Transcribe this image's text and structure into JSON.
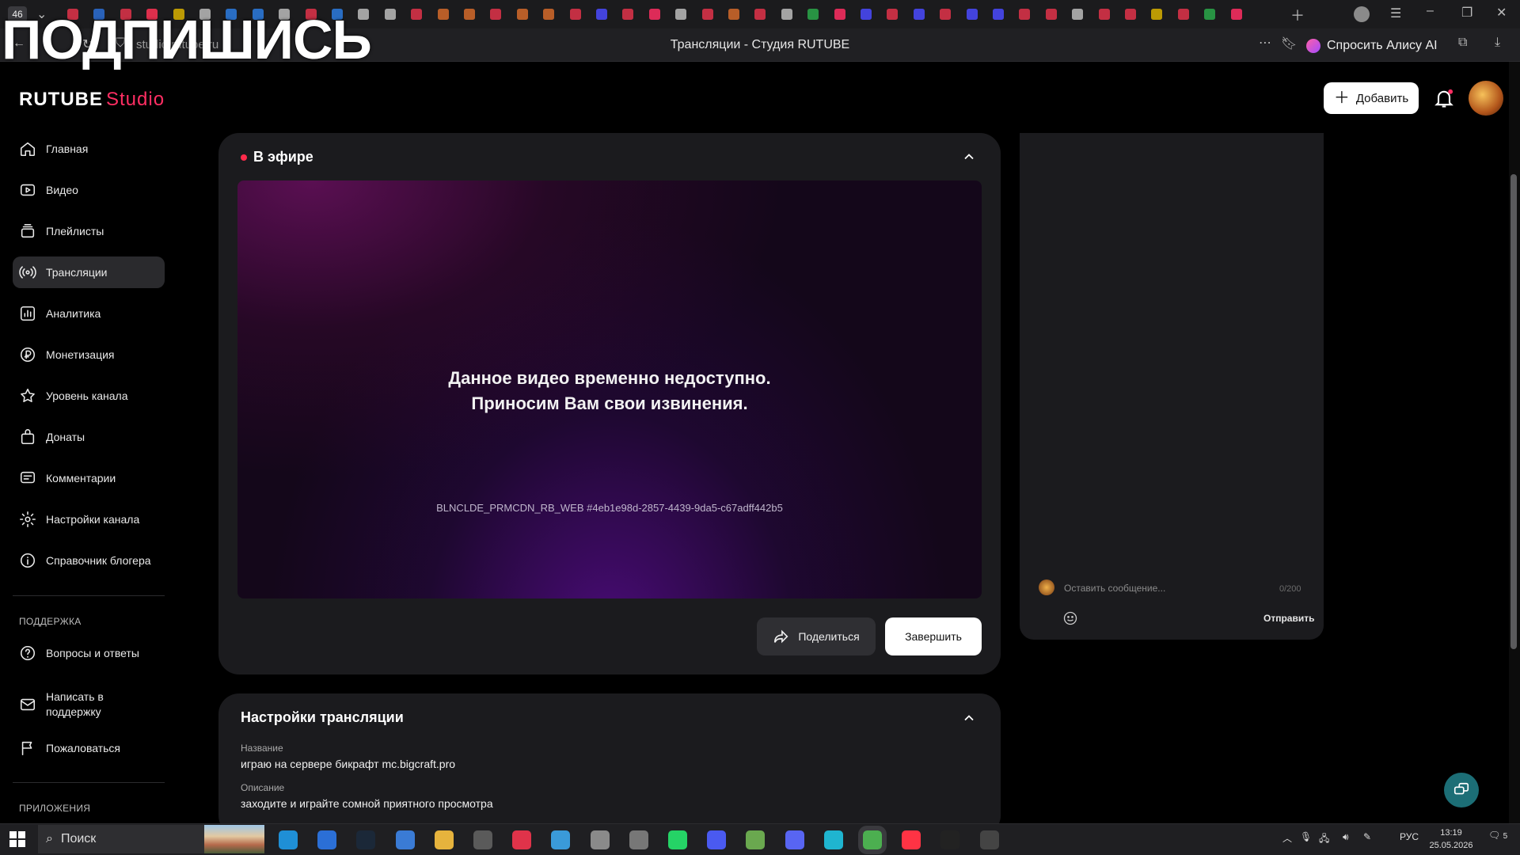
{
  "overlay": {
    "text": "ПОДПИШИСЬ"
  },
  "browser": {
    "tab_count": "46",
    "url": "studio.rutube.ru",
    "page_title": "Трансляции - Студия RUTUBE",
    "alice_label": "Спросить Алису AI"
  },
  "header": {
    "logo_main": "RUTUBE",
    "logo_sub": "Studio",
    "add_label": "Добавить"
  },
  "sidebar": {
    "items": [
      {
        "label": "Главная"
      },
      {
        "label": "Видео"
      },
      {
        "label": "Плейлисты"
      },
      {
        "label": "Трансляции"
      },
      {
        "label": "Аналитика"
      },
      {
        "label": "Монетизация"
      },
      {
        "label": "Уровень канала"
      },
      {
        "label": "Донаты"
      },
      {
        "label": "Комментарии"
      },
      {
        "label": "Настройки канала"
      },
      {
        "label": "Справочник блогера"
      }
    ],
    "support_heading": "ПОДДЕРЖКА",
    "support_items": [
      {
        "label": "Вопросы и ответы"
      },
      {
        "label": "Написать в поддержку"
      },
      {
        "label": "Пожаловаться"
      }
    ],
    "apps_heading": "ПРИЛОЖЕНИЯ"
  },
  "live": {
    "title": "В эфире",
    "message_line1": "Данное видео временно недоступно.",
    "message_line2": "Приносим Вам свои извинения.",
    "error_code": "BLNCLDE_PRMCDN_RB_WEB #4eb1e98d-2857-4439-9da5-c67adff442b5",
    "share_label": "Поделиться",
    "end_label": "Завершить"
  },
  "settings": {
    "title": "Настройки трансляции",
    "name_label": "Название",
    "name_value": "играю на сервере бикрафт mc.bigcraft.pro",
    "desc_label": "Описание",
    "desc_value": "заходите и играйте сомной приятного просмотра"
  },
  "chat": {
    "placeholder": "Оставить сообщение...",
    "counter": "0/200",
    "send_label": "Отправить"
  },
  "taskbar": {
    "search_label": "Поиск",
    "lang": "РУС",
    "time": "13:19",
    "date": "25.05.2026",
    "notif_count": "5"
  },
  "colors": {
    "accent": "#ff2e63",
    "live_dot": "#ff2b4b",
    "card_bg": "#1b1b1e",
    "help_fab": "#1c6e76"
  }
}
